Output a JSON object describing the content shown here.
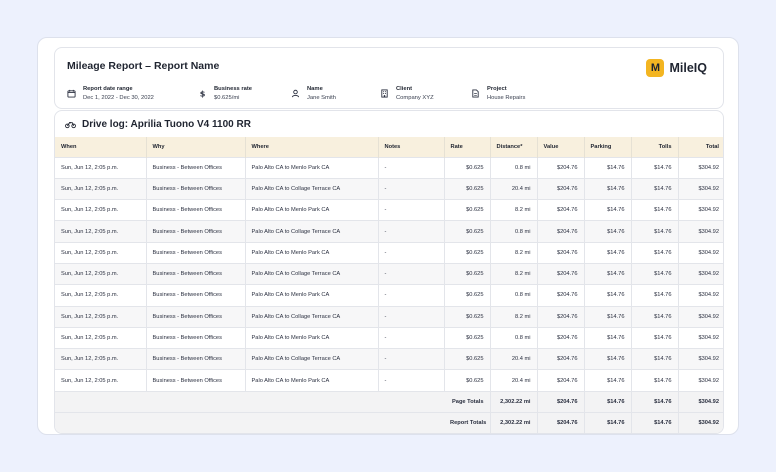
{
  "report": {
    "title": "Mileage Report – Report Name",
    "brand": {
      "mark": "M",
      "name": "MileIQ",
      "mark_color": "#f3b521"
    },
    "meta": [
      {
        "icon": "calendar-icon",
        "label": "Report date range",
        "value": "Dec 1, 2022 - Dec 30, 2022"
      },
      {
        "icon": "dollar-icon",
        "label": "Business rate",
        "value": "$0.625/mi"
      },
      {
        "icon": "person-icon",
        "label": "Name",
        "value": "Jane Smith"
      },
      {
        "icon": "building-icon",
        "label": "Client",
        "value": "Company XYZ"
      },
      {
        "icon": "document-icon",
        "label": "Project",
        "value": "House Repairs"
      }
    ]
  },
  "drive_log": {
    "title": "Drive log: Aprilia Tuono V4 1100 RR",
    "icon": "motorcycle-icon",
    "columns": [
      "When",
      "Why",
      "Where",
      "Notes",
      "Rate",
      "Distance*",
      "Value",
      "Parking",
      "Tolls",
      "Total"
    ],
    "rows": [
      [
        "Sun, Jun 12, 2:05 p.m.",
        "Business - Between Offices",
        "Palo Alto CA to Menlo Park CA",
        "-",
        "$0.625",
        "0.8 mi",
        "$204.76",
        "$14.76",
        "$14.76",
        "$304.92"
      ],
      [
        "Sun, Jun 12, 2:05 p.m.",
        "Business - Between Offices",
        "Palo Alto CA to Collage Terrace CA",
        "-",
        "$0.625",
        "20.4 mi",
        "$204.76",
        "$14.76",
        "$14.76",
        "$304.92"
      ],
      [
        "Sun, Jun 12, 2:05 p.m.",
        "Business - Between Offices",
        "Palo Alto CA to Menlo Park CA",
        "-",
        "$0.625",
        "8.2 mi",
        "$204.76",
        "$14.76",
        "$14.76",
        "$304.92"
      ],
      [
        "Sun, Jun 12, 2:05 p.m.",
        "Business - Between Offices",
        "Palo Alto CA to Collage Terrace CA",
        "-",
        "$0.625",
        "0.8 mi",
        "$204.76",
        "$14.76",
        "$14.76",
        "$304.92"
      ],
      [
        "Sun, Jun 12, 2:05 p.m.",
        "Business - Between Offices",
        "Palo Alto CA to Menlo Park CA",
        "-",
        "$0.625",
        "8.2 mi",
        "$204.76",
        "$14.76",
        "$14.76",
        "$304.92"
      ],
      [
        "Sun, Jun 12, 2:05 p.m.",
        "Business - Between Offices",
        "Palo Alto CA to Collage Terrace CA",
        "-",
        "$0.625",
        "8.2 mi",
        "$204.76",
        "$14.76",
        "$14.76",
        "$304.92"
      ],
      [
        "Sun, Jun 12, 2:05 p.m.",
        "Business - Between Offices",
        "Palo Alto CA to Menlo Park CA",
        "-",
        "$0.625",
        "0.8 mi",
        "$204.76",
        "$14.76",
        "$14.76",
        "$304.92"
      ],
      [
        "Sun, Jun 12, 2:05 p.m.",
        "Business - Between Offices",
        "Palo Alto CA to Collage Terrace CA",
        "-",
        "$0.625",
        "8.2 mi",
        "$204.76",
        "$14.76",
        "$14.76",
        "$304.92"
      ],
      [
        "Sun, Jun 12, 2:05 p.m.",
        "Business - Between Offices",
        "Palo Alto CA to Menlo Park CA",
        "-",
        "$0.625",
        "0.8 mi",
        "$204.76",
        "$14.76",
        "$14.76",
        "$304.92"
      ],
      [
        "Sun, Jun 12, 2:05 p.m.",
        "Business - Between Offices",
        "Palo Alto CA to Collage Terrace CA",
        "-",
        "$0.625",
        "20.4 mi",
        "$204.76",
        "$14.76",
        "$14.76",
        "$304.92"
      ],
      [
        "Sun, Jun 12, 2:05 p.m.",
        "Business - Between Offices",
        "Palo Alto CA to Menlo Park CA",
        "-",
        "$0.625",
        "20.4 mi",
        "$204.76",
        "$14.76",
        "$14.76",
        "$304.92"
      ]
    ],
    "totals": [
      {
        "label": "Page Totals",
        "distance": "2,302.22 mi",
        "value": "$204.76",
        "parking": "$14.76",
        "tolls": "$14.76",
        "total": "$304.92"
      },
      {
        "label": "Report Totals",
        "distance": "2,302.22 mi",
        "value": "$204.76",
        "parking": "$14.76",
        "tolls": "$14.76",
        "total": "$304.92"
      }
    ]
  }
}
